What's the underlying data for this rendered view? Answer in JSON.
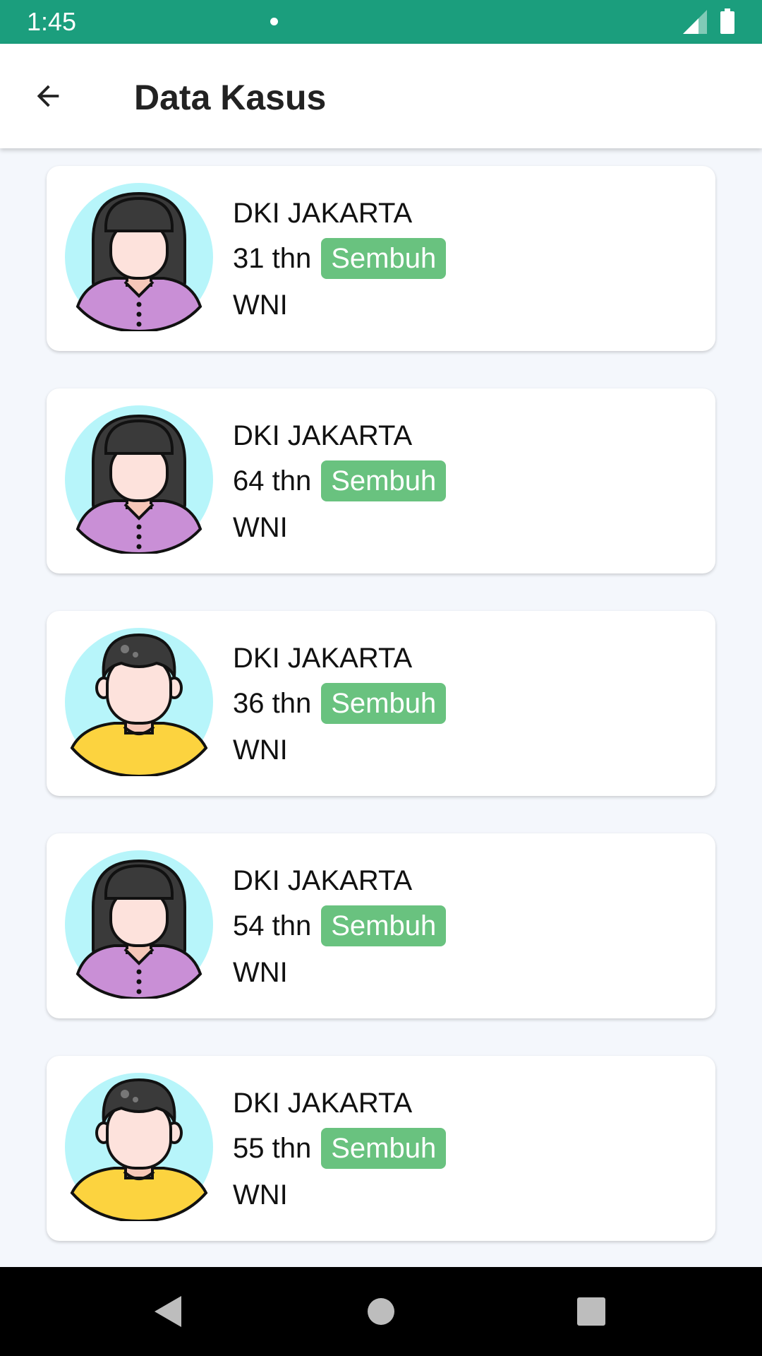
{
  "status_bar": {
    "time": "1:45"
  },
  "app_bar": {
    "title": "Data Kasus",
    "back_icon": "arrow-left-icon"
  },
  "cases": [
    {
      "province": "DKI JAKARTA",
      "age": "31 thn",
      "status": "Sembuh",
      "nationality": "WNI",
      "avatar": "female-avatar-icon"
    },
    {
      "province": "DKI JAKARTA",
      "age": "64 thn",
      "status": "Sembuh",
      "nationality": "WNI",
      "avatar": "female-avatar-icon"
    },
    {
      "province": "DKI JAKARTA",
      "age": "36 thn",
      "status": "Sembuh",
      "nationality": "WNI",
      "avatar": "male-avatar-icon"
    },
    {
      "province": "DKI JAKARTA",
      "age": "54 thn",
      "status": "Sembuh",
      "nationality": "WNI",
      "avatar": "female-avatar-icon"
    },
    {
      "province": "DKI JAKARTA",
      "age": "55 thn",
      "status": "Sembuh",
      "nationality": "WNI",
      "avatar": "male-avatar-icon"
    }
  ],
  "colors": {
    "status_bar": "#1b9e7d",
    "badge": "#69c27f",
    "avatar_bg": "#b7f5fa",
    "female_shirt": "#c98fd6",
    "male_shirt": "#fcd33f"
  }
}
